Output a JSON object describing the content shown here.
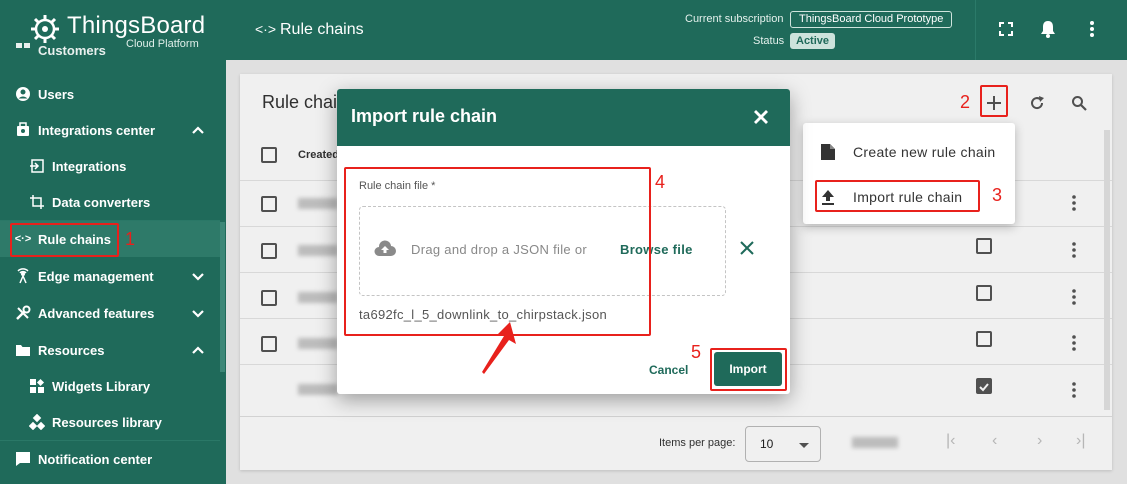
{
  "app": {
    "title": "ThingsBoard",
    "subtitle": "Cloud Platform"
  },
  "sidebar": {
    "items": [
      {
        "label": "Customers"
      },
      {
        "label": "Users"
      },
      {
        "label": "Integrations center"
      },
      {
        "label": "Integrations"
      },
      {
        "label": "Data converters"
      },
      {
        "label": "Rule chains"
      },
      {
        "label": "Edge management"
      },
      {
        "label": "Advanced features"
      },
      {
        "label": "Resources"
      },
      {
        "label": "Widgets Library"
      },
      {
        "label": "Resources library"
      },
      {
        "label": "Notification center"
      }
    ]
  },
  "header": {
    "page_title": "Rule chains",
    "subscription_label": "Current subscription",
    "subscription_value": "ThingsBoard Cloud Prototype",
    "status_label": "Status",
    "status_value": "Active"
  },
  "content": {
    "title": "Rule chains",
    "column_created": "Created",
    "items_per_page_label": "Items per page:",
    "items_per_page_value": "10"
  },
  "dialog": {
    "title": "Import rule chain",
    "field_label": "Rule chain file *",
    "drop_text": "Drag and drop a JSON file or",
    "browse_label": "Browse file",
    "file_name": "ta692fc_l_5_downlink_to_chirpstack.json",
    "cancel_label": "Cancel",
    "import_label": "Import"
  },
  "menu": {
    "items": [
      {
        "label": "Create new rule chain",
        "icon": "file-icon"
      },
      {
        "label": "Import rule chain",
        "icon": "upload-icon"
      }
    ]
  },
  "annotations": [
    "1",
    "2",
    "3",
    "4",
    "5"
  ],
  "colors": {
    "brand": "#1f6a5a",
    "annotation": "#e8211c"
  }
}
